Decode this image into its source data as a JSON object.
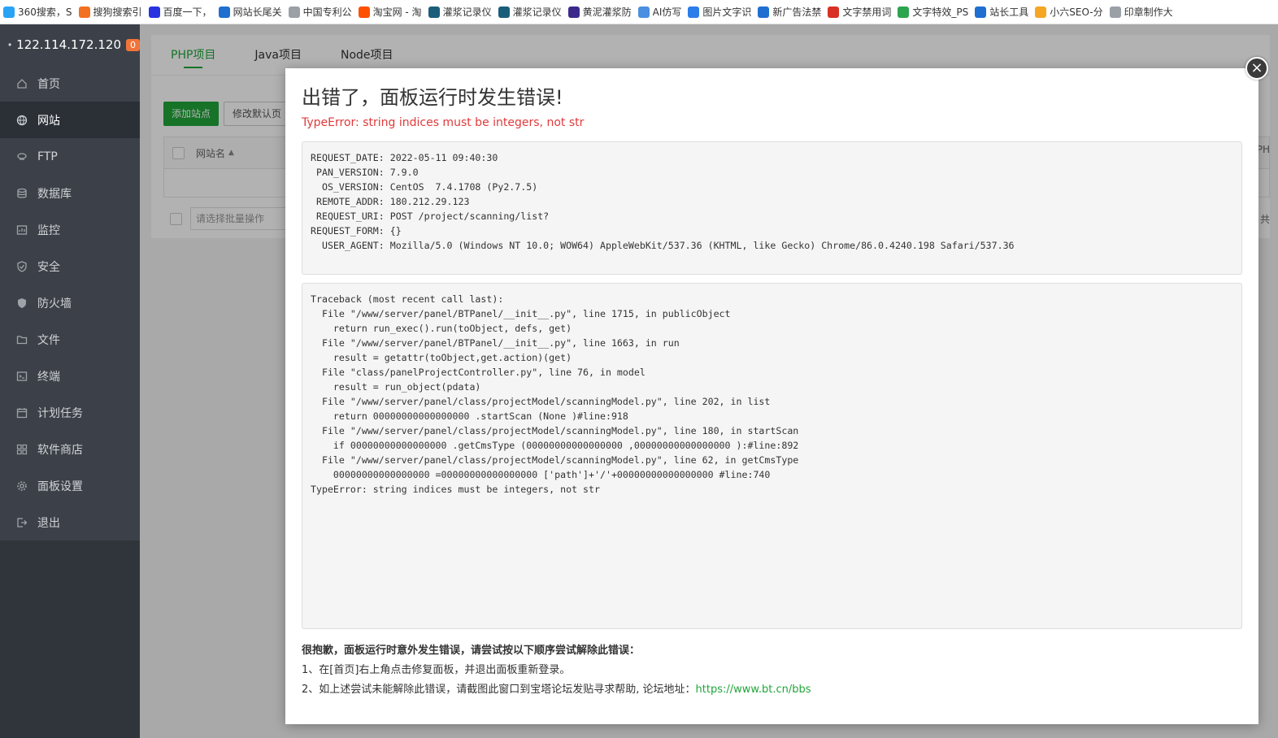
{
  "bookmarks": [
    {
      "label": "360搜索，S",
      "color": "#2aa3f5"
    },
    {
      "label": "搜狗搜索引",
      "color": "#f36f21"
    },
    {
      "label": "百度一下，",
      "color": "#2932e1"
    },
    {
      "label": "网站长尾关",
      "color": "#1f6fd0"
    },
    {
      "label": "中国专利公",
      "color": "#9aa0a6"
    },
    {
      "label": "淘宝网 - 淘",
      "color": "#ff5000"
    },
    {
      "label": "灌浆记录仪",
      "color": "#1b5e7a"
    },
    {
      "label": "灌浆记录仪",
      "color": "#1b5e7a"
    },
    {
      "label": "黄泥灌浆防",
      "color": "#3b2a8c"
    },
    {
      "label": "AI仿写",
      "color": "#4a8fe0"
    },
    {
      "label": "图片文字识",
      "color": "#2b7de9"
    },
    {
      "label": "新广告法禁",
      "color": "#1f6fd0"
    },
    {
      "label": "文字禁用词",
      "color": "#d93025"
    },
    {
      "label": "文字特效_PS",
      "color": "#2da44e"
    },
    {
      "label": "站长工具",
      "color": "#1f6fd0"
    },
    {
      "label": "小六SEO-分",
      "color": "#f5a623"
    },
    {
      "label": "印章制作大",
      "color": "#9aa0a6"
    }
  ],
  "sidebar": {
    "server_ip": "122.114.172.120",
    "badge": "0",
    "items": [
      {
        "label": "首页",
        "icon": "home-icon"
      },
      {
        "label": "网站",
        "icon": "globe-icon"
      },
      {
        "label": "FTP",
        "icon": "ftp-icon"
      },
      {
        "label": "数据库",
        "icon": "database-icon"
      },
      {
        "label": "监控",
        "icon": "monitor-icon"
      },
      {
        "label": "安全",
        "icon": "shield-check-icon"
      },
      {
        "label": "防火墙",
        "icon": "firewall-icon"
      },
      {
        "label": "文件",
        "icon": "folder-icon"
      },
      {
        "label": "终端",
        "icon": "terminal-icon"
      },
      {
        "label": "计划任务",
        "icon": "calendar-icon"
      },
      {
        "label": "软件商店",
        "icon": "apps-icon"
      },
      {
        "label": "面板设置",
        "icon": "gear-icon"
      },
      {
        "label": "退出",
        "icon": "logout-icon"
      }
    ]
  },
  "main": {
    "tabs": [
      "PHP项目",
      "Java项目",
      "Node项目"
    ],
    "add_site": "添加站点",
    "modify_default": "修改默认页",
    "col_sitename": "网站名",
    "bulk_placeholder": "请选择批量操作",
    "right_stub_1": "PH",
    "right_stub_2": "共"
  },
  "modal": {
    "title": "出错了，面板运行时发生错误!",
    "error": "TypeError: string indices must be integers, not str",
    "request_info": "REQUEST_DATE: 2022-05-11 09:40:30\n PAN_VERSION: 7.9.0\n  OS_VERSION: CentOS  7.4.1708 (Py2.7.5)\n REMOTE_ADDR: 180.212.29.123\n REQUEST_URI: POST /project/scanning/list?\nREQUEST_FORM: {}\n  USER_AGENT: Mozilla/5.0 (Windows NT 10.0; WOW64) AppleWebKit/537.36 (KHTML, like Gecko) Chrome/86.0.4240.198 Safari/537.36",
    "traceback": "Traceback (most recent call last):\n  File \"/www/server/panel/BTPanel/__init__.py\", line 1715, in publicObject\n    return run_exec().run(toObject, defs, get)\n  File \"/www/server/panel/BTPanel/__init__.py\", line 1663, in run\n    result = getattr(toObject,get.action)(get)\n  File \"class/panelProjectController.py\", line 76, in model\n    result = run_object(pdata)\n  File \"/www/server/panel/class/projectModel/scanningModel.py\", line 202, in list\n    return 00000000000000000 .startScan (None )#line:918\n  File \"/www/server/panel/class/projectModel/scanningModel.py\", line 180, in startScan\n    if 00000000000000000 .getCmsType (00000000000000000 ,00000000000000000 ):#line:892\n  File \"/www/server/panel/class/projectModel/scanningModel.py\", line 62, in getCmsType\n    00000000000000000 =00000000000000000 ['path']+'/'+00000000000000000 #line:740\nTypeError: string indices must be integers, not str",
    "help_title": "很抱歉，面板运行时意外发生错误，请尝试按以下顺序尝试解除此错误：",
    "help_line1": "1、在[首页]右上角点击修复面板，并退出面板重新登录。",
    "help_line2_prefix": "2、如上述尝试未能解除此错误，请截图此窗口到宝塔论坛发贴寻求帮助, 论坛地址：",
    "help_link": "https://www.bt.cn/bbs",
    "close": "×"
  }
}
